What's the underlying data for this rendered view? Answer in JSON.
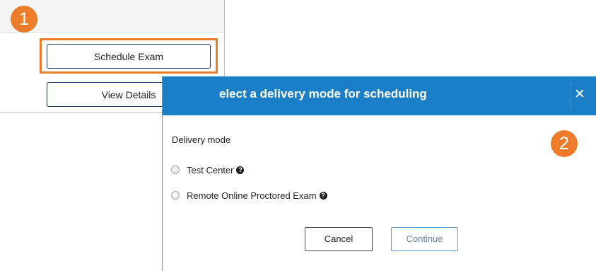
{
  "steps": {
    "step1": "1",
    "step2": "2"
  },
  "panel1": {
    "schedule_label": "Schedule Exam",
    "details_label": "View Details"
  },
  "modal": {
    "title": "elect a delivery mode for scheduling",
    "close_label": "✕",
    "field_label": "Delivery mode",
    "options": [
      {
        "label": "Test Center",
        "selected": false
      },
      {
        "label": "Remote Online Proctored Exam",
        "selected": false
      }
    ],
    "help_icon": "?",
    "cancel_label": "Cancel",
    "continue_label": "Continue"
  },
  "colors": {
    "accent_orange": "#ec7b2a",
    "header_blue": "#1a7fc6",
    "button_border": "#1b3a5c"
  },
  "icons": {
    "close": "close-icon",
    "help": "help-circle-icon",
    "radio": "radio-button-icon"
  }
}
